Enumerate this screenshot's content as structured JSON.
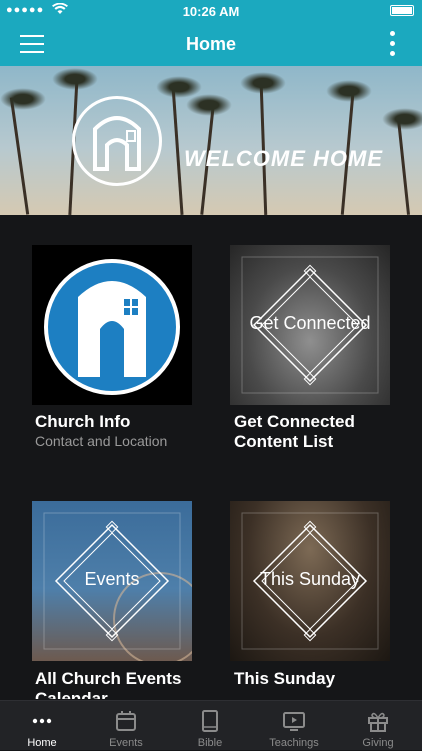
{
  "status_bar": {
    "time": "10:26 AM",
    "signal": "●●●●●"
  },
  "nav": {
    "title": "Home"
  },
  "hero": {
    "welcome_text": "WELCOME HOME"
  },
  "cards": [
    {
      "title": "Church Info",
      "subtitle": "Contact and Location"
    },
    {
      "title": "Get Connected Content List",
      "overlay": "Get Connected"
    },
    {
      "title": "All Church Events Calendar",
      "overlay": "Events"
    },
    {
      "title": "This Sunday",
      "overlay": "This Sunday"
    }
  ],
  "tabs": [
    {
      "label": "Home",
      "icon": "more-dots-icon",
      "active": true
    },
    {
      "label": "Events",
      "icon": "calendar-icon",
      "active": false
    },
    {
      "label": "Bible",
      "icon": "book-icon",
      "active": false
    },
    {
      "label": "Teachings",
      "icon": "video-icon",
      "active": false
    },
    {
      "label": "Giving",
      "icon": "gift-icon",
      "active": false
    }
  ],
  "colors": {
    "accent": "#1ba9bf",
    "background": "#151618",
    "logo_blue": "#1d7fc2"
  }
}
